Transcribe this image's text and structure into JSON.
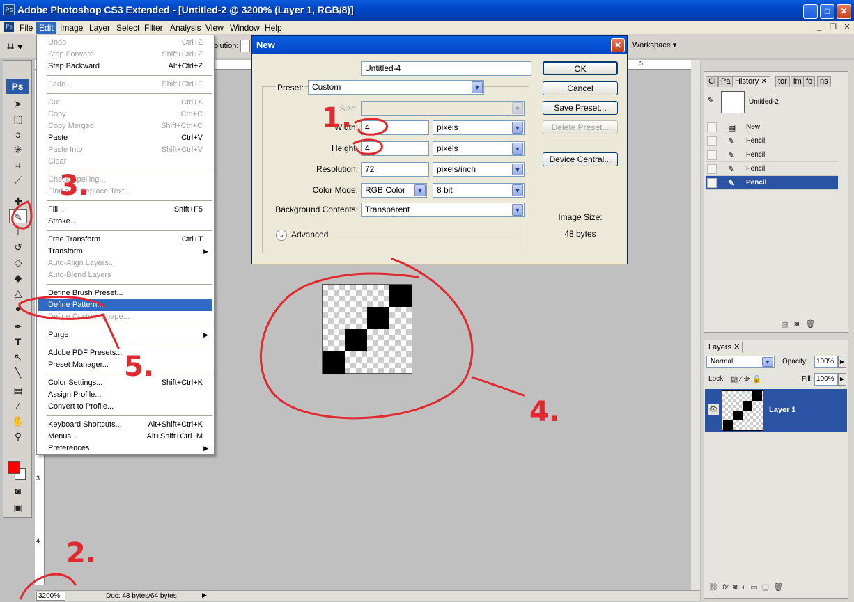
{
  "window": {
    "title": "Adobe Photoshop CS3 Extended - [Untitled-2 @ 3200% (Layer 1, RGB/8)]",
    "app_icon": "Ps"
  },
  "menubar": {
    "items": [
      "File",
      "Edit",
      "Image",
      "Layer",
      "Select",
      "Filter",
      "Analysis",
      "View",
      "Window",
      "Help"
    ],
    "active": "Edit"
  },
  "options_bar": {
    "resolution_label": "olution:",
    "workspace_label": "Workspace"
  },
  "toolbox": {
    "ps_logo": "Ps"
  },
  "edit_menu": {
    "groups": [
      [
        {
          "label": "Undo",
          "shortcut": "Ctrl+Z",
          "disabled": true
        },
        {
          "label": "Step Forward",
          "shortcut": "Shift+Ctrl+Z",
          "disabled": true
        },
        {
          "label": "Step Backward",
          "shortcut": "Alt+Ctrl+Z",
          "disabled": false
        }
      ],
      [
        {
          "label": "Fade...",
          "shortcut": "Shift+Ctrl+F",
          "disabled": true
        }
      ],
      [
        {
          "label": "Cut",
          "shortcut": "Ctrl+X",
          "disabled": true
        },
        {
          "label": "Copy",
          "shortcut": "Ctrl+C",
          "disabled": true
        },
        {
          "label": "Copy Merged",
          "shortcut": "Shift+Ctrl+C",
          "disabled": true
        },
        {
          "label": "Paste",
          "shortcut": "Ctrl+V",
          "disabled": false
        },
        {
          "label": "Paste Into",
          "shortcut": "Shift+Ctrl+V",
          "disabled": true
        },
        {
          "label": "Clear",
          "shortcut": "",
          "disabled": true
        }
      ],
      [
        {
          "label": "Check Spelling...",
          "shortcut": "",
          "disabled": true
        },
        {
          "label": "Find and Replace Text...",
          "shortcut": "",
          "disabled": true
        }
      ],
      [
        {
          "label": "Fill...",
          "shortcut": "Shift+F5",
          "disabled": false
        },
        {
          "label": "Stroke...",
          "shortcut": "",
          "disabled": false
        }
      ],
      [
        {
          "label": "Free Transform",
          "shortcut": "Ctrl+T",
          "disabled": false
        },
        {
          "label": "Transform",
          "shortcut": "",
          "disabled": false,
          "submenu": true
        },
        {
          "label": "Auto-Align Layers...",
          "shortcut": "",
          "disabled": true
        },
        {
          "label": "Auto-Blend Layers",
          "shortcut": "",
          "disabled": true
        }
      ],
      [
        {
          "label": "Define Brush Preset...",
          "shortcut": "",
          "disabled": false
        },
        {
          "label": "Define Pattern...",
          "shortcut": "",
          "disabled": false,
          "highlighted": true
        },
        {
          "label": "Define Custom Shape...",
          "shortcut": "",
          "disabled": true
        }
      ],
      [
        {
          "label": "Purge",
          "shortcut": "",
          "disabled": false,
          "submenu": true
        }
      ],
      [
        {
          "label": "Adobe PDF Presets...",
          "shortcut": "",
          "disabled": false
        },
        {
          "label": "Preset Manager...",
          "shortcut": "",
          "disabled": false
        }
      ],
      [
        {
          "label": "Color Settings...",
          "shortcut": "Shift+Ctrl+K",
          "disabled": false
        },
        {
          "label": "Assign Profile...",
          "shortcut": "",
          "disabled": false
        },
        {
          "label": "Convert to Profile...",
          "shortcut": "",
          "disabled": false
        }
      ],
      [
        {
          "label": "Keyboard Shortcuts...",
          "shortcut": "Alt+Shift+Ctrl+K",
          "disabled": false
        },
        {
          "label": "Menus...",
          "shortcut": "Alt+Shift+Ctrl+M",
          "disabled": false
        },
        {
          "label": "Preferences",
          "shortcut": "",
          "disabled": false,
          "submenu": true
        }
      ]
    ]
  },
  "new_dialog": {
    "title": "New",
    "name_label": "Name:",
    "name_value": "Untitled-4",
    "preset_label": "Preset:",
    "preset_value": "Custom",
    "size_label": "Size:",
    "width_label": "Width:",
    "width_value": "4",
    "width_unit": "pixels",
    "height_label": "Height:",
    "height_value": "4",
    "height_unit": "pixels",
    "resolution_label": "Resolution:",
    "resolution_value": "72",
    "resolution_unit": "pixels/inch",
    "color_mode_label": "Color Mode:",
    "color_mode_value": "RGB Color",
    "bit_depth": "8 bit",
    "background_label": "Background Contents:",
    "background_value": "Transparent",
    "advanced_label": "Advanced",
    "buttons": {
      "ok": "OK",
      "cancel": "Cancel",
      "save_preset": "Save Preset...",
      "delete_preset": "Delete Preset...",
      "device_central": "Device Central..."
    },
    "image_size_label": "Image Size:",
    "image_size_value": "48 bytes"
  },
  "history_panel": {
    "tabs": [
      "Cl",
      "Pa",
      "History",
      "tor",
      "im",
      "fo",
      "ns"
    ],
    "snapshot": "Untitled-2",
    "states": [
      "New",
      "Pencil",
      "Pencil",
      "Pencil",
      "Pencil"
    ],
    "selected_index": 4
  },
  "layers_panel": {
    "tab": "Layers",
    "blend_mode": "Normal",
    "opacity_label": "Opacity:",
    "opacity_value": "100%",
    "lock_label": "Lock:",
    "fill_label": "Fill:",
    "fill_value": "100%",
    "layer_name": "Layer 1",
    "footer_icons": [
      "link-icon",
      "fx-icon",
      "mask-icon",
      "adjustment-icon",
      "group-icon",
      "new-layer-icon",
      "trash-icon"
    ]
  },
  "status_bar": {
    "zoom": "3200%",
    "doc_info": "Doc: 48 bytes/64 bytes"
  },
  "rulers": {
    "h_mark": "5",
    "v_marks": [
      "3",
      "4"
    ]
  },
  "annotations": [
    "1.",
    "2.",
    "3.",
    "4.",
    "5."
  ],
  "colors": {
    "foreground": "#ff0000",
    "background": "#ffffff",
    "selection": "#316ac5",
    "annotation": "#e0282e"
  }
}
